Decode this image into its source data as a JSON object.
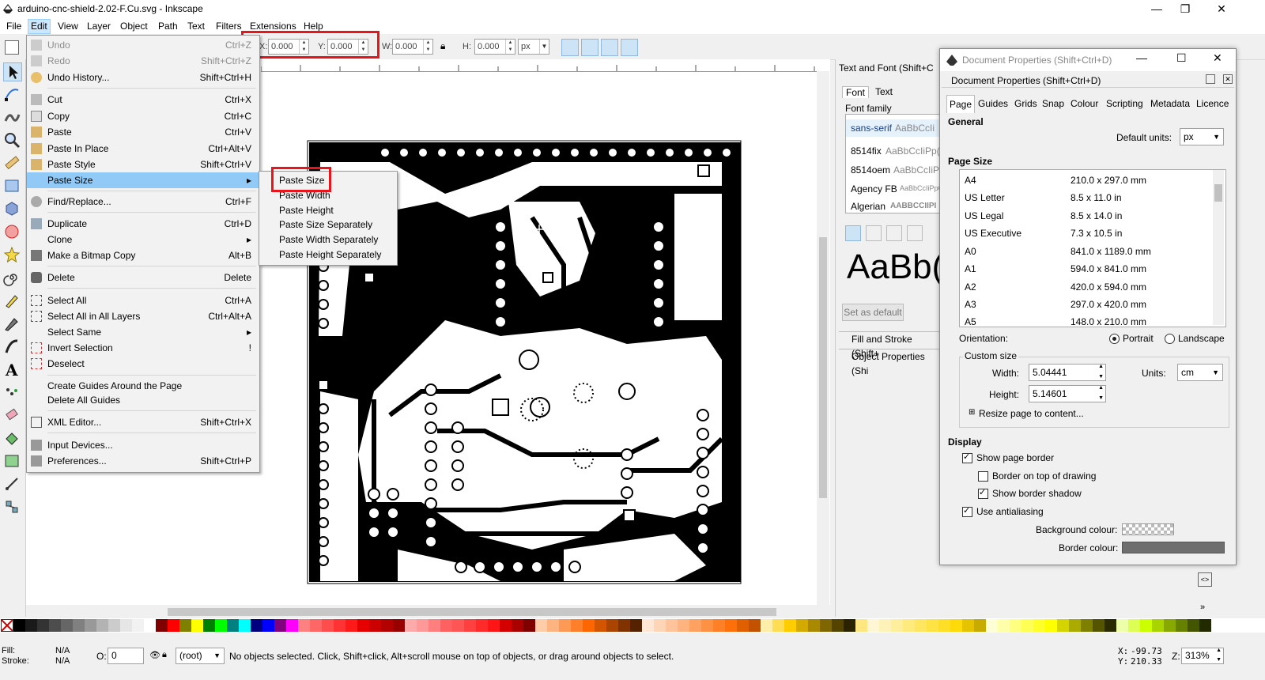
{
  "window": {
    "title": "arduino-cnc-shield-2.02-F.Cu.svg - Inkscape",
    "min": "—",
    "max": "❐",
    "close": "✕"
  },
  "menubar": [
    "File",
    "Edit",
    "View",
    "Layer",
    "Object",
    "Path",
    "Text",
    "Filters",
    "Extensions",
    "Help"
  ],
  "toolbar": {
    "x_label": "X:",
    "x_value": "0.000",
    "y_label": "Y:",
    "y_value": "0.000",
    "w_label": "W:",
    "w_value": "0.000",
    "h_label": "H:",
    "h_value": "0.000",
    "unit": "px"
  },
  "edit_menu": [
    {
      "label": "Undo",
      "shortcut": "Ctrl+Z",
      "disabled": true
    },
    {
      "label": "Redo",
      "shortcut": "Shift+Ctrl+Z",
      "disabled": true
    },
    {
      "label": "Undo History...",
      "shortcut": "Shift+Ctrl+H"
    },
    {
      "label": "Cut",
      "shortcut": "Ctrl+X"
    },
    {
      "label": "Copy",
      "shortcut": "Ctrl+C"
    },
    {
      "label": "Paste",
      "shortcut": "Ctrl+V"
    },
    {
      "label": "Paste In Place",
      "shortcut": "Ctrl+Alt+V"
    },
    {
      "label": "Paste Style",
      "shortcut": "Shift+Ctrl+V"
    },
    {
      "label": "Paste Size",
      "shortcut": "▸"
    },
    {
      "label": "Find/Replace...",
      "shortcut": "Ctrl+F"
    },
    {
      "label": "Duplicate",
      "shortcut": "Ctrl+D"
    },
    {
      "label": "Clone",
      "shortcut": "▸"
    },
    {
      "label": "Make a Bitmap Copy",
      "shortcut": "Alt+B"
    },
    {
      "label": "Delete",
      "shortcut": "Delete"
    },
    {
      "label": "Select All",
      "shortcut": "Ctrl+A"
    },
    {
      "label": "Select All in All Layers",
      "shortcut": "Ctrl+Alt+A"
    },
    {
      "label": "Select Same",
      "shortcut": "▸"
    },
    {
      "label": "Invert Selection",
      "shortcut": "!"
    },
    {
      "label": "Deselect",
      "shortcut": ""
    },
    {
      "label": "Create Guides Around the Page",
      "shortcut": ""
    },
    {
      "label": "Delete All Guides",
      "shortcut": ""
    },
    {
      "label": "XML Editor...",
      "shortcut": "Shift+Ctrl+X"
    },
    {
      "label": "Input Devices...",
      "shortcut": ""
    },
    {
      "label": "Preferences...",
      "shortcut": "Shift+Ctrl+P"
    }
  ],
  "paste_size_submenu": [
    "Paste Size",
    "Paste Width",
    "Paste Height",
    "Paste Size Separately",
    "Paste Width Separately",
    "Paste Height Separately"
  ],
  "text_font_panel": {
    "title": "Text and Font (Shift+C",
    "tabs": [
      "Font",
      "Text"
    ],
    "font_family_label": "Font family",
    "fonts": [
      {
        "name": "sans-serif",
        "sample": "AaBbCcIi"
      },
      {
        "name": "8514fix",
        "sample": "AaBbCcIiPp("
      },
      {
        "name": "8514oem",
        "sample": "AaBbCcIiPr"
      },
      {
        "name": "Agency FB",
        "sample": "AaBbCcIiPpQ("
      },
      {
        "name": "Algerian",
        "sample": "AABBCCIIPI"
      }
    ],
    "preview": "AaBb(",
    "set_default": "Set as default",
    "fill_stroke": "Fill and Stroke (Shift+",
    "object_props": "Object Properties (Shi"
  },
  "doc_props": {
    "window_title": "Document Properties (Shift+Ctrl+D)",
    "panel_title": "Document Properties (Shift+Ctrl+D)",
    "tabs": [
      "Page",
      "Guides",
      "Grids",
      "Snap",
      "Colour",
      "Scripting",
      "Metadata",
      "Licence"
    ],
    "general_label": "General",
    "default_units_label": "Default units:",
    "default_units_value": "px",
    "page_size_label": "Page Size",
    "page_sizes": [
      {
        "name": "A4",
        "size": "210.0 x 297.0 mm"
      },
      {
        "name": "US Letter",
        "size": "8.5 x 11.0 in"
      },
      {
        "name": "US Legal",
        "size": "8.5 x 14.0 in"
      },
      {
        "name": "US Executive",
        "size": "7.3 x 10.5 in"
      },
      {
        "name": "A0",
        "size": "841.0 x 1189.0 mm"
      },
      {
        "name": "A1",
        "size": "594.0 x 841.0 mm"
      },
      {
        "name": "A2",
        "size": "420.0 x 594.0 mm"
      },
      {
        "name": "A3",
        "size": "297.0 x 420.0 mm"
      },
      {
        "name": "A5",
        "size": "148.0 x 210.0 mm"
      }
    ],
    "orientation_label": "Orientation:",
    "portrait": "Portrait",
    "landscape": "Landscape",
    "custom_size_label": "Custom size",
    "width_label": "Width:",
    "width_value": "5.04441",
    "height_label": "Height:",
    "height_value": "5.14601",
    "units_label": "Units:",
    "units_value": "cm",
    "resize_label": "Resize page to content...",
    "display_label": "Display",
    "show_border": "Show page border",
    "border_on_top": "Border on top of drawing",
    "show_shadow": "Show border shadow",
    "antialias": "Use antialiasing",
    "bg_colour": "Background colour:",
    "border_colour": "Border colour:",
    "border_colour_hex": "#6e6e6e"
  },
  "status": {
    "fill_label": "Fill:",
    "fill_value": "N/A",
    "stroke_label": "Stroke:",
    "stroke_value": "N/A",
    "opacity_label": "O:",
    "opacity_value": "0",
    "layer": "(root)",
    "message": "No objects selected. Click, Shift+click, Alt+scroll mouse on top of objects, or drag around objects to select.",
    "x_label": "X:",
    "x": "-99.73",
    "y_label": "Y:",
    "y": "210.33",
    "zoom_label": "Z:",
    "zoom": "313%"
  },
  "palette_colors": [
    "#000000",
    "#1a1a1a",
    "#333333",
    "#4d4d4d",
    "#666666",
    "#808080",
    "#999999",
    "#b3b3b3",
    "#cccccc",
    "#e6e6e6",
    "#f2f2f2",
    "#ffffff",
    "#800000",
    "#ff0000",
    "#808000",
    "#ffff00",
    "#008000",
    "#00ff00",
    "#008080",
    "#00ffff",
    "#000080",
    "#0000ff",
    "#800080",
    "#ff00ff",
    "#ff8080",
    "#ff6666",
    "#ff4d4d",
    "#ff3333",
    "#ff1a1a",
    "#e60000",
    "#cc0000",
    "#b30000",
    "#990000",
    "#ffaaaa",
    "#ff9999",
    "#ff7f7f",
    "#ff6060",
    "#ff5555",
    "#ff4040",
    "#ff2a2a",
    "#ff1515",
    "#d40000",
    "#aa0000",
    "#800000",
    "#ffccaa",
    "#ffb380",
    "#ff9955",
    "#ff7f2a",
    "#ff6600",
    "#d45500",
    "#aa4400",
    "#803300",
    "#552200",
    "#ffe6d5",
    "#ffd5b8",
    "#ffc49b",
    "#ffb37e",
    "#ffa261",
    "#ff9144",
    "#ff8027",
    "#ff6f0a",
    "#e05f00",
    "#c35200",
    "#ffeeaa",
    "#ffdd55",
    "#ffcc00",
    "#d4aa00",
    "#aa8800",
    "#806600",
    "#554400",
    "#2b2200",
    "#ffe680",
    "#fff6d5",
    "#fff2b8",
    "#ffee9b",
    "#ffea7e",
    "#ffe661",
    "#ffe244",
    "#ffde27",
    "#ffda0a",
    "#e6c300",
    "#c9ab00",
    "#ffffd5",
    "#ffffaa",
    "#ffff80",
    "#ffff55",
    "#ffff2a",
    "#ffff00",
    "#d4d400",
    "#aaaa00",
    "#808000",
    "#555500",
    "#2b2b00",
    "#eeffaa",
    "#ddff55",
    "#ccff00",
    "#aad400",
    "#88aa00",
    "#668000",
    "#445500",
    "#222b00"
  ]
}
